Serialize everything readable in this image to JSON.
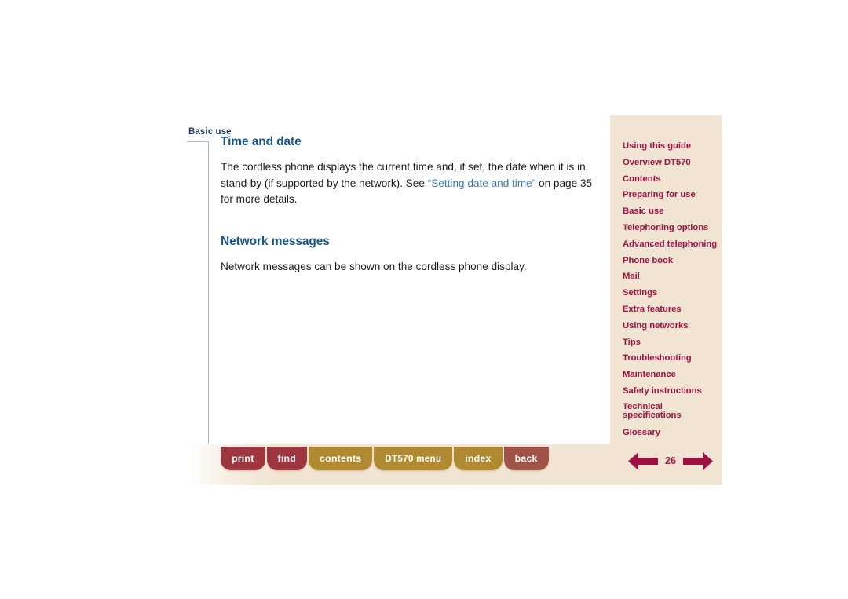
{
  "document": {
    "running_head": "Basic use",
    "page_number": "26"
  },
  "content": {
    "sections": [
      {
        "title": "Time and date",
        "paragraph_before_link": "The cordless phone displays the current time and, if set, the date when it is in stand-by (if supported by the network). See ",
        "link_text": "“Setting date and time”",
        "paragraph_after_link": " on page 35 for more details."
      },
      {
        "title": "Network messages",
        "paragraph": "Network messages can be shown on the cordless phone display."
      }
    ]
  },
  "nav_panel": {
    "items": [
      {
        "label": "Using this guide",
        "two_line": false
      },
      {
        "label": "Overview DT570",
        "two_line": false
      },
      {
        "label": "Contents",
        "two_line": false
      },
      {
        "label": "Preparing for use",
        "two_line": false
      },
      {
        "label": "Basic use",
        "two_line": false
      },
      {
        "label": "Telephoning options",
        "two_line": false
      },
      {
        "label": "Advanced telephoning",
        "two_line": false
      },
      {
        "label": "Phone book",
        "two_line": false
      },
      {
        "label": "Mail",
        "two_line": false
      },
      {
        "label": "Settings",
        "two_line": false
      },
      {
        "label": "Extra features",
        "two_line": false
      },
      {
        "label": "Using networks",
        "two_line": false
      },
      {
        "label": "Tips",
        "two_line": false
      },
      {
        "label": "Troubleshooting",
        "two_line": false
      },
      {
        "label": "Maintenance",
        "two_line": false
      },
      {
        "label": "Safety instructions",
        "two_line": false
      },
      {
        "label": "Technical specifications",
        "two_line": true
      },
      {
        "label": "Glossary",
        "two_line": false
      }
    ]
  },
  "toolbar": {
    "buttons": [
      {
        "label": "print",
        "style": "red",
        "mono": false
      },
      {
        "label": "find",
        "style": "red",
        "mono": false
      },
      {
        "label": "contents",
        "style": "gold",
        "mono": false
      },
      {
        "label": "DT570 menu",
        "style": "gold",
        "mono": true
      },
      {
        "label": "index",
        "style": "gold",
        "mono": false
      },
      {
        "label": "back",
        "style": "brick",
        "mono": false
      }
    ]
  },
  "colors": {
    "panel_bg": "#f1e4d2",
    "nav_link": "#9e1142",
    "heading_blue": "#16558f",
    "xref_blue": "#3d7cb0",
    "rule": "#9fb6c6",
    "btn_red": "#9e3640",
    "btn_gold": "#b08a31",
    "btn_brick": "#a05448"
  }
}
